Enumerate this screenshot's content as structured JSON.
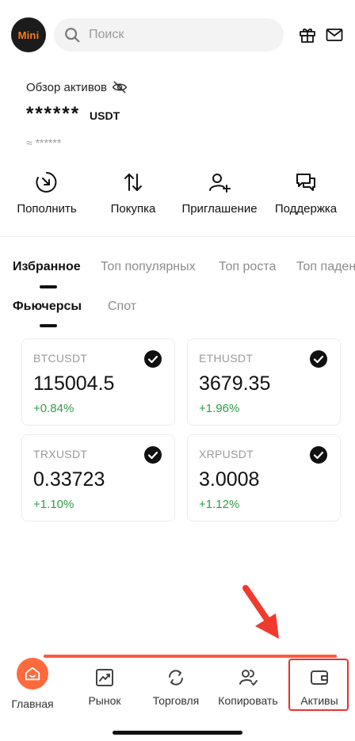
{
  "header": {
    "logo_text": "Mini",
    "search_placeholder": "Поиск"
  },
  "overview": {
    "title": "Обзор активов",
    "balance_masked": "******",
    "currency": "USDT",
    "approx": "≈ ******"
  },
  "actions": [
    {
      "label": "Пополнить",
      "icon": "deposit-icon"
    },
    {
      "label": "Покупка",
      "icon": "buy-arrows-icon"
    },
    {
      "label": "Приглашение",
      "icon": "invite-user-icon"
    },
    {
      "label": "Поддержка",
      "icon": "support-chat-icon"
    }
  ],
  "tabs": [
    "Избранное",
    "Топ популярных",
    "Топ роста",
    "Топ падения"
  ],
  "subtabs": [
    "Фьючерсы",
    "Спот"
  ],
  "cards": [
    {
      "symbol": "BTCUSDT",
      "price": "115004.5",
      "change": "+0.84%"
    },
    {
      "symbol": "ETHUSDT",
      "price": "3679.35",
      "change": "+1.96%"
    },
    {
      "symbol": "TRXUSDT",
      "price": "0.33723",
      "change": "+1.10%"
    },
    {
      "symbol": "XRPUSDT",
      "price": "3.0008",
      "change": "+1.12%"
    }
  ],
  "nav": [
    {
      "label": "Главная",
      "icon": "home-icon"
    },
    {
      "label": "Рынок",
      "icon": "market-chart-icon"
    },
    {
      "label": "Торговля",
      "icon": "trade-swap-icon"
    },
    {
      "label": "Копировать",
      "icon": "copy-trade-icon"
    },
    {
      "label": "Активы",
      "icon": "wallet-icon"
    }
  ],
  "colors": {
    "accent": "#ff6a3d",
    "positive": "#2ea043",
    "annotation": "#e8322b"
  }
}
